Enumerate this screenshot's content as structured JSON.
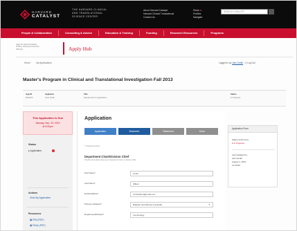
{
  "header": {
    "logo_line1": "HARVARD",
    "logo_line2": "CATALYST",
    "center_lines": [
      "THE HARVARD CLINICAL",
      "AND TRANSLATIONAL",
      "SCIENCE CENTER"
    ],
    "top_links": [
      "About Harvard Catalyst",
      "Harvard Clinical Translational",
      "Contact Us"
    ],
    "icons_links": [
      "Share",
      "Profiles",
      "Navigate"
    ],
    "search_placeholder": "SEARCH CATALYST",
    "brand_red": "#c8102e"
  },
  "nav": {
    "items": [
      "People & Collaboration",
      "Consulting & Advice",
      "Education & Training",
      "Funding",
      "Research Resources",
      "Programs"
    ]
  },
  "hub": {
    "left_text": [
      "Apply for Harvard Catalyst",
      "funding, training and services",
      "offerings"
    ],
    "title": "Apply Hub"
  },
  "breadcrumbs": [
    "Home",
    "My Applications"
  ],
  "user": {
    "logged_in_as": "Logged in as",
    "name": "John Smith",
    "logout": "Log Out"
  },
  "page_title": "Master's Program in Clinical and Translational Investigation Fall 2013",
  "info": [
    {
      "h": "App ID",
      "v": "MA0123"
    },
    {
      "h": "Applicant",
      "v": "Jane Smith"
    },
    {
      "h": "Title",
      "v": "Sample title for application..."
    },
    {
      "h": "Status",
      "v": "In Progress"
    }
  ],
  "sidebar": {
    "closed_line1": "This Application is Due",
    "closed_line2": "Monday, Sep. 23, 2013",
    "closed_line3": "at 5:00pm",
    "status_heading": "Status",
    "status_item": "Application",
    "actions_heading": "Actions",
    "actions_link": "View My Application",
    "resources_heading": "Resources",
    "resources": [
      "RFA (PDF)",
      "FAQs (PDF)"
    ]
  },
  "application": {
    "title": "Application",
    "steps": [
      "Application",
      "Biosketch",
      "Statement",
      "Done"
    ],
    "required_note": "*= Required Field",
    "section_title": "Department Chair/Division Chief",
    "section_sub": "Provide information about your department chair or division chief.",
    "fields": [
      {
        "label": "First Name*",
        "value": "Curtis"
      },
      {
        "label": "Last Name*",
        "value": "Wilson"
      },
      {
        "label": "Email Address*",
        "value": "curtiswilson@email.com"
      },
      {
        "label": "Primary Institution*",
        "value": "Brigham and Women's Hospital"
      },
      {
        "label": "Department/Division*",
        "value": "Immunology"
      }
    ]
  },
  "right_panel": {
    "heading": "Application Form",
    "status_label": "Status of this form:",
    "status_value": "In Progress",
    "last_updated_label": "Last Updated by:",
    "last_updated_by": "John Smith",
    "date": "August 1, 2013",
    "time": "11:37AM"
  }
}
